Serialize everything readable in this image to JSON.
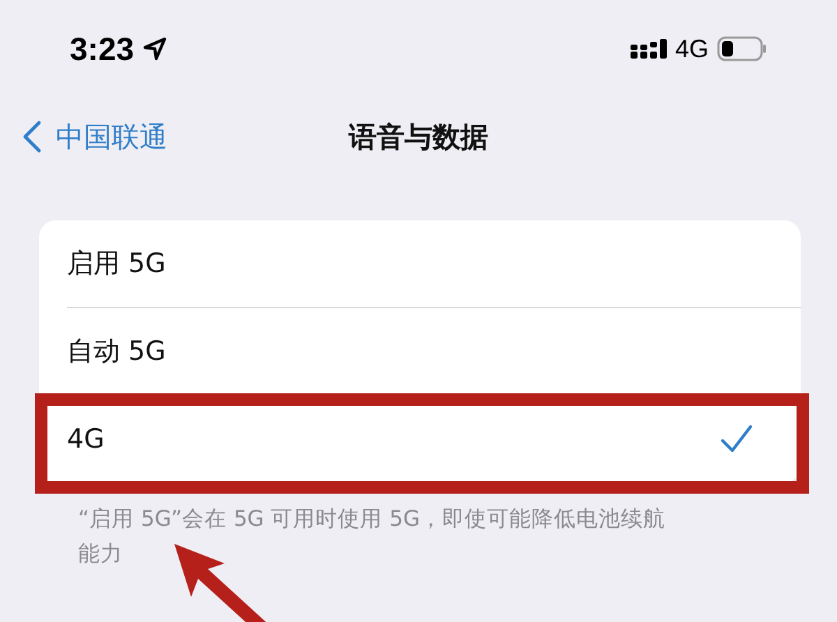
{
  "status_bar": {
    "time": "3:23",
    "network": "4G"
  },
  "nav": {
    "back": "中国联通",
    "title": "语音与数据"
  },
  "options": [
    {
      "label": "启用 5G",
      "selected": false,
      "highlighted": false
    },
    {
      "label": "自动 5G",
      "selected": false,
      "highlighted": false
    },
    {
      "label": "4G",
      "selected": true,
      "highlighted": true
    }
  ],
  "footnote": "“启用 5G”会在 5G 可用时使用 5G，即使可能降低电池续航能力"
}
